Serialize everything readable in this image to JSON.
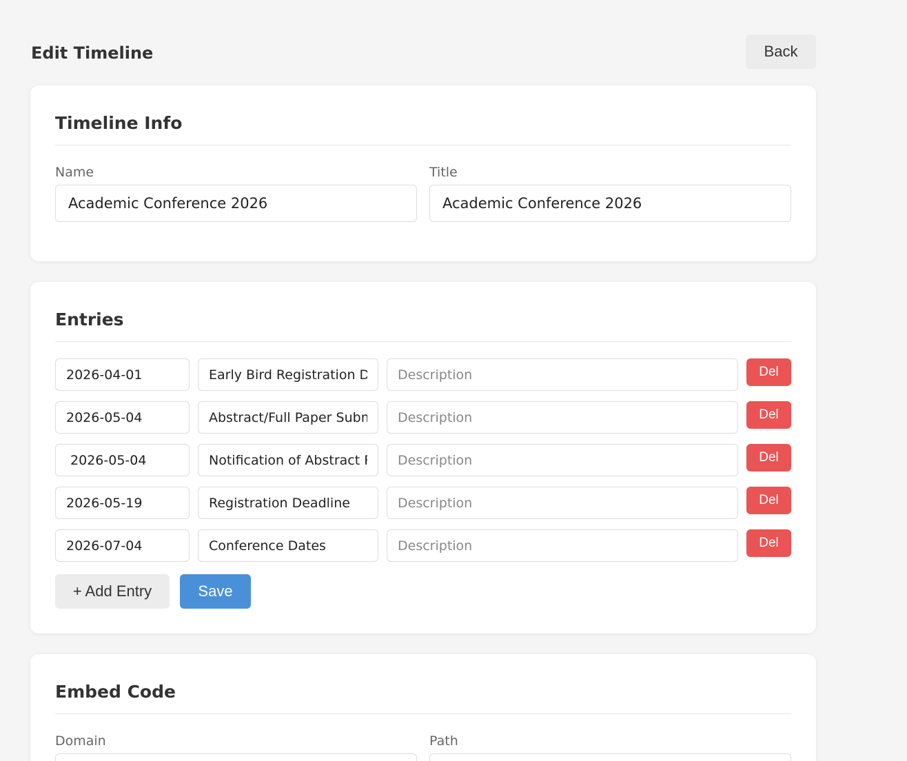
{
  "header": {
    "title": "Edit Timeline",
    "back_label": "Back"
  },
  "timeline_info": {
    "heading": "Timeline Info",
    "name_label": "Name",
    "name_value": "Academic Conference 2026",
    "title_label": "Title",
    "title_value": "Academic Conference 2026"
  },
  "entries": {
    "heading": "Entries",
    "description_placeholder": "Description",
    "delete_label": "Del",
    "rows": [
      {
        "date": "2026-04-01",
        "name": "Early Bird Registration Deadline",
        "description": ""
      },
      {
        "date": "2026-05-04",
        "name": "Abstract/Full Paper Submission",
        "description": ""
      },
      {
        "date": " 2026-05-04",
        "name": "Notification of Abstract Review",
        "description": ""
      },
      {
        "date": "2026-05-19",
        "name": "Registration Deadline",
        "description": ""
      },
      {
        "date": "2026-07-04",
        "name": "Conference Dates",
        "description": ""
      }
    ],
    "add_label": "+ Add Entry",
    "save_label": "Save"
  },
  "embed_code": {
    "heading": "Embed Code",
    "domain_label": "Domain",
    "path_label": "Path"
  },
  "colors": {
    "background": "#f5f5f5",
    "card": "#ffffff",
    "primary": "#4a90d9",
    "danger": "#ea5455",
    "secondary_button": "#ececec"
  }
}
